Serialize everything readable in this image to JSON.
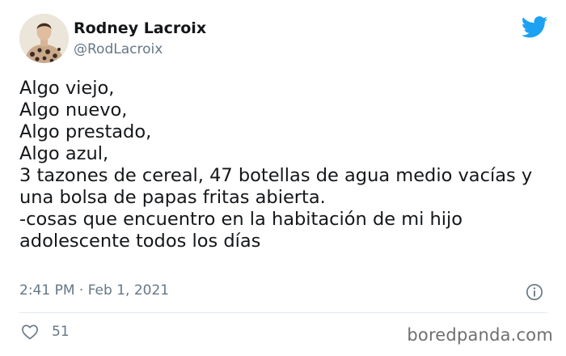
{
  "author": {
    "name": "Rodney Lacroix",
    "handle": "@RodLacroix"
  },
  "tweet": {
    "lines": [
      "Algo viejo,",
      "Algo nuevo,",
      "Algo prestado,",
      "Algo azul,",
      "3 tazones de cereal, 47 botellas de agua medio vacías y",
      "una bolsa de papas fritas abierta.",
      "-cosas que encuentro en la habitación de mi hijo",
      "adolescente todos los días"
    ],
    "timestamp": "2:41 PM · Feb 1, 2021"
  },
  "engagement": {
    "likes": "51"
  },
  "watermark": "boredpanda.com",
  "icons": {
    "brand": "twitter-bird-icon",
    "info": "info-icon",
    "like": "heart-icon"
  },
  "colors": {
    "twitter_blue": "#1da1f2",
    "text_primary": "#14171a",
    "text_secondary": "#657786",
    "divider": "#e1e8ed"
  }
}
